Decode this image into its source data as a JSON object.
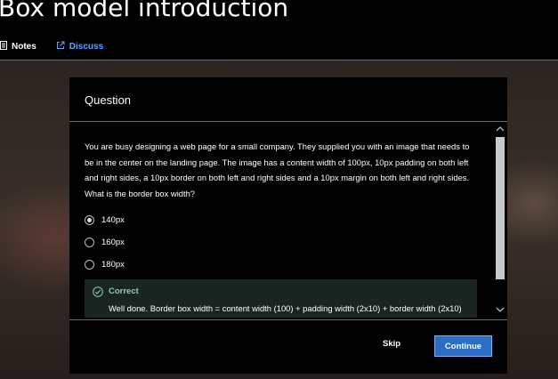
{
  "course": {
    "title": "Box model introduction"
  },
  "tabs": [
    {
      "label": "Notes",
      "icon": "notes-icon"
    },
    {
      "label": "Discuss",
      "icon": "external-link-icon"
    }
  ],
  "modal": {
    "title": "Question",
    "question": "You are busy designing a web page for a small company. They supplied you with an image that needs to be in the center on the landing page. The image has a content width of 100px, 10px padding on both left and right sides, a 10px border on both left and right sides and a 10px margin on both left and right sides. What is the border box width?",
    "options": [
      {
        "label": "140px",
        "selected": true
      },
      {
        "label": "160px",
        "selected": false
      },
      {
        "label": "180px",
        "selected": false
      }
    ],
    "feedback": {
      "status": "Correct",
      "text": "Well done. Border box width = content width (100) + padding width (2x10) + border width (2x10)"
    },
    "footer": {
      "skip_label": "Skip",
      "continue_label": "Continue"
    }
  },
  "colors": {
    "accent": "#2b6cc4",
    "link": "#5aa5ff",
    "correct": "#7fd3a8"
  }
}
